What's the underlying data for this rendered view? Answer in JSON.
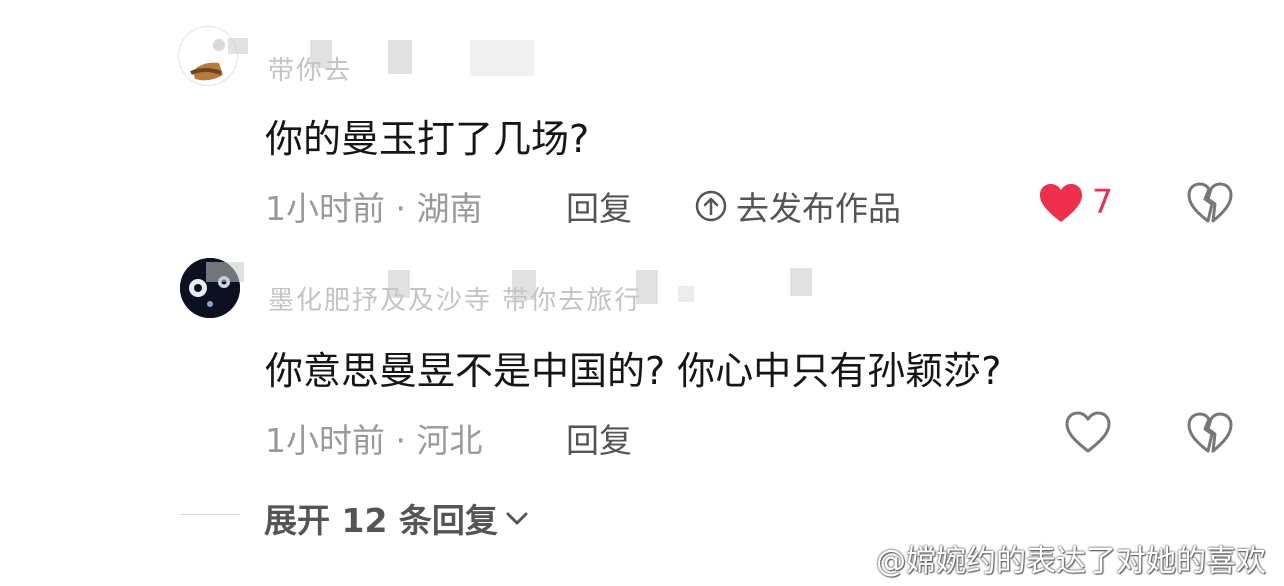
{
  "comments": [
    {
      "username_visible": "带你去",
      "text": "你的曼玉打了几场?",
      "time_location": "1小时前 · 湖南",
      "reply_label": "回复",
      "publish_label": "去发布作品",
      "like_count": "7",
      "liked": true
    },
    {
      "username_visible": "墨化肥抒及及沙寺 带你去旅行",
      "text": "你意思曼昱不是中国的? 你心中只有孙颖莎?",
      "time_location": "1小时前 · 河北",
      "reply_label": "回复",
      "liked": false
    }
  ],
  "expand_label": "展开 12 条回复",
  "watermark": "@嫦婉约的表达了对她的喜欢",
  "colors": {
    "like": "#ef2f4c",
    "meta": "#9a9a9a",
    "text": "#161616"
  }
}
